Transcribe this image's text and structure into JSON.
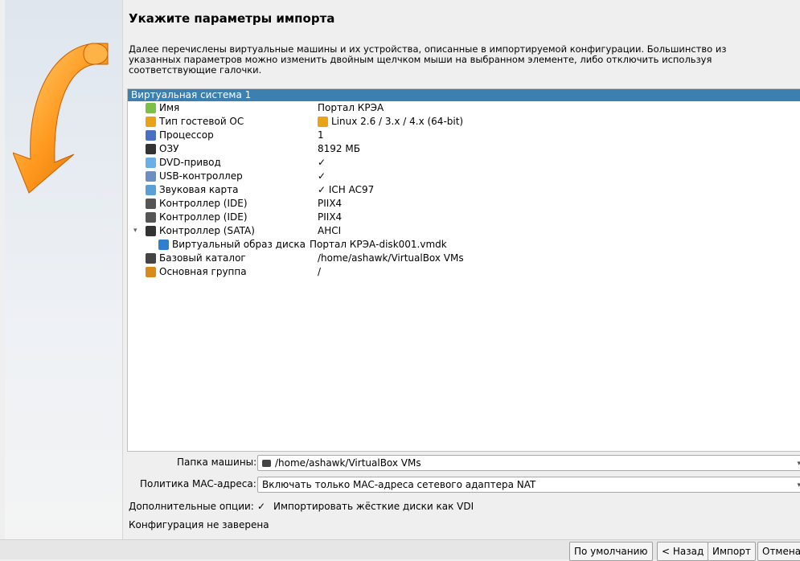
{
  "header": {
    "title": "Укажите параметры импорта",
    "description": "Далее перечислены виртуальные машины и их устройства, описанные в импортируемой конфигурации. Большинство из указанных параметров можно изменить двойным щелчком мыши на выбранном элементе, либо отключить используя соответствующие галочки."
  },
  "tree": {
    "system_label": "Виртуальная система 1",
    "rows": [
      {
        "key": "Имя",
        "value": "Портал КРЭА",
        "icon": "name-icon",
        "color": "#7cc04a"
      },
      {
        "key": "Тип гостевой ОС",
        "value": "Linux 2.6 / 3.x / 4.x (64-bit)",
        "icon": "os-type-icon",
        "color": "#e8a317"
      },
      {
        "key": "Процессор",
        "value": "1",
        "icon": "cpu-icon",
        "color": "#4a6fc2"
      },
      {
        "key": "ОЗУ",
        "value": "8192 МБ",
        "icon": "ram-icon",
        "color": "#333333"
      },
      {
        "key": "DVD-привод",
        "value": "✓",
        "icon": "dvd-icon",
        "color": "#6ab0e8"
      },
      {
        "key": "USB-контроллер",
        "value": "✓",
        "icon": "usb-icon",
        "color": "#6a8fc2"
      },
      {
        "key": "Звуковая карта",
        "value": "✓  ICH AC97",
        "icon": "sound-card-icon",
        "color": "#5aa0d8"
      },
      {
        "key": "Контроллер (IDE)",
        "value": "PIIX4",
        "icon": "ide-controller-icon",
        "color": "#555555"
      },
      {
        "key": "Контроллер (IDE)",
        "value": "PIIX4",
        "icon": "ide-controller-icon",
        "color": "#555555"
      },
      {
        "key": "Контроллер (SATA)",
        "value": "AHCI",
        "icon": "sata-controller-icon",
        "color": "#333333"
      },
      {
        "key": "Виртуальный образ диска",
        "value": "Портал КРЭА-disk001.vmdk",
        "icon": "disk-image-icon",
        "color": "#2f7fcf"
      },
      {
        "key": "Базовый каталог",
        "value": "/home/ashawk/VirtualBox VMs",
        "icon": "folder-icon",
        "color": "#444444"
      },
      {
        "key": "Основная группа",
        "value": "/",
        "icon": "group-icon",
        "color": "#d98a1a"
      }
    ]
  },
  "form": {
    "machine_folder_label": "Папка машины:",
    "machine_folder_value": "/home/ashawk/VirtualBox VMs",
    "mac_policy_label": "Политика MAC-адреса:",
    "mac_policy_value": "Включать только MAC-адреса сетевого адаптера NAT",
    "extra_options_label": "Дополнительные опции:",
    "import_vdi_label": "Импортировать жёсткие диски как VDI",
    "config_status": "Конфигурация не заверена"
  },
  "buttons": {
    "defaults": "По умолчанию",
    "back": "< Назад",
    "import": "Импорт",
    "cancel": "Отмена"
  }
}
